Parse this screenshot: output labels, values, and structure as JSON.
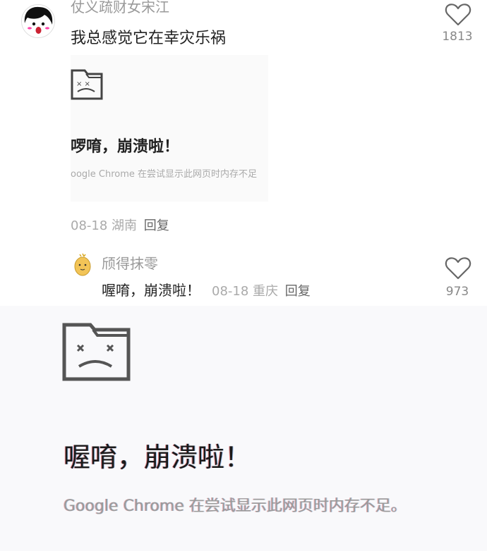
{
  "comment": {
    "username": "仗义疏财女宋江",
    "text": "我总感觉它在幸灾乐祸",
    "like_count": "1813",
    "image": {
      "title": "啰唷，崩溃啦！",
      "description": "oogle Chrome 在尝试显示此网页时内存不足"
    },
    "meta": {
      "date": "08-18",
      "location": "湖南",
      "reply_label": "回复"
    }
  },
  "reply": {
    "username": "颀得抹零",
    "text": "喔唷，崩溃啦！",
    "date": "08-18",
    "location": "重庆",
    "reply_label": "回复",
    "like_count": "973"
  },
  "crash_page": {
    "title": "喔唷，崩溃啦！",
    "description": "Google Chrome 在尝试显示此网页时内存不足。"
  },
  "icons": {
    "like": "heart-outline-icon",
    "crash": "sad-folder-icon"
  }
}
